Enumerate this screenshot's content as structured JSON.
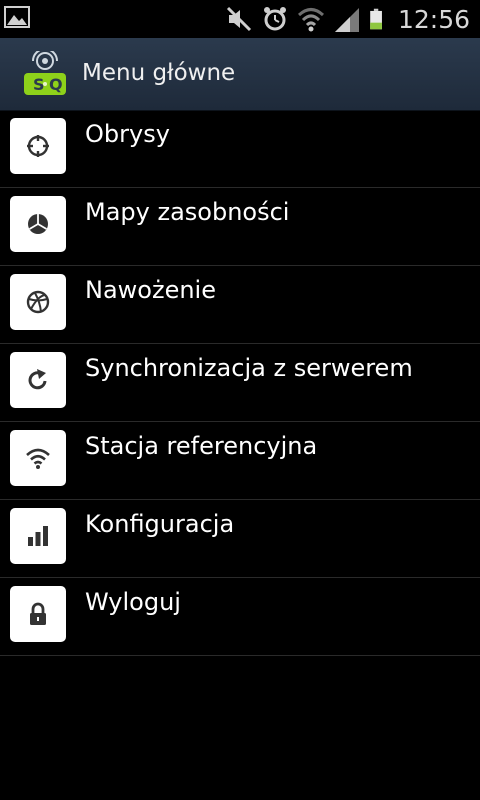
{
  "status_bar": {
    "time": "12:56",
    "icons": [
      "gallery-icon",
      "mute-icon",
      "alarm-icon",
      "wifi-icon",
      "signal-icon",
      "battery-icon"
    ]
  },
  "header": {
    "title": "Menu główne",
    "logo_icon": "sq-app-logo"
  },
  "menu": {
    "items": [
      {
        "label": "Obrysy",
        "icon": "crosshair-icon"
      },
      {
        "label": "Mapy zasobności",
        "icon": "pie-chart-icon"
      },
      {
        "label": "Nawożenie",
        "icon": "ball-icon"
      },
      {
        "label": "Synchronizacja z serwerem",
        "icon": "refresh-icon"
      },
      {
        "label": "Stacja referencyjna",
        "icon": "wifi-icon"
      },
      {
        "label": "Konfiguracja",
        "icon": "bar-chart-icon"
      },
      {
        "label": "Wyloguj",
        "icon": "lock-icon"
      }
    ]
  },
  "colors": {
    "header_bg": "#243245",
    "background": "#000000",
    "battery_green": "#8ec63f",
    "logo_green": "#8ed11a"
  }
}
